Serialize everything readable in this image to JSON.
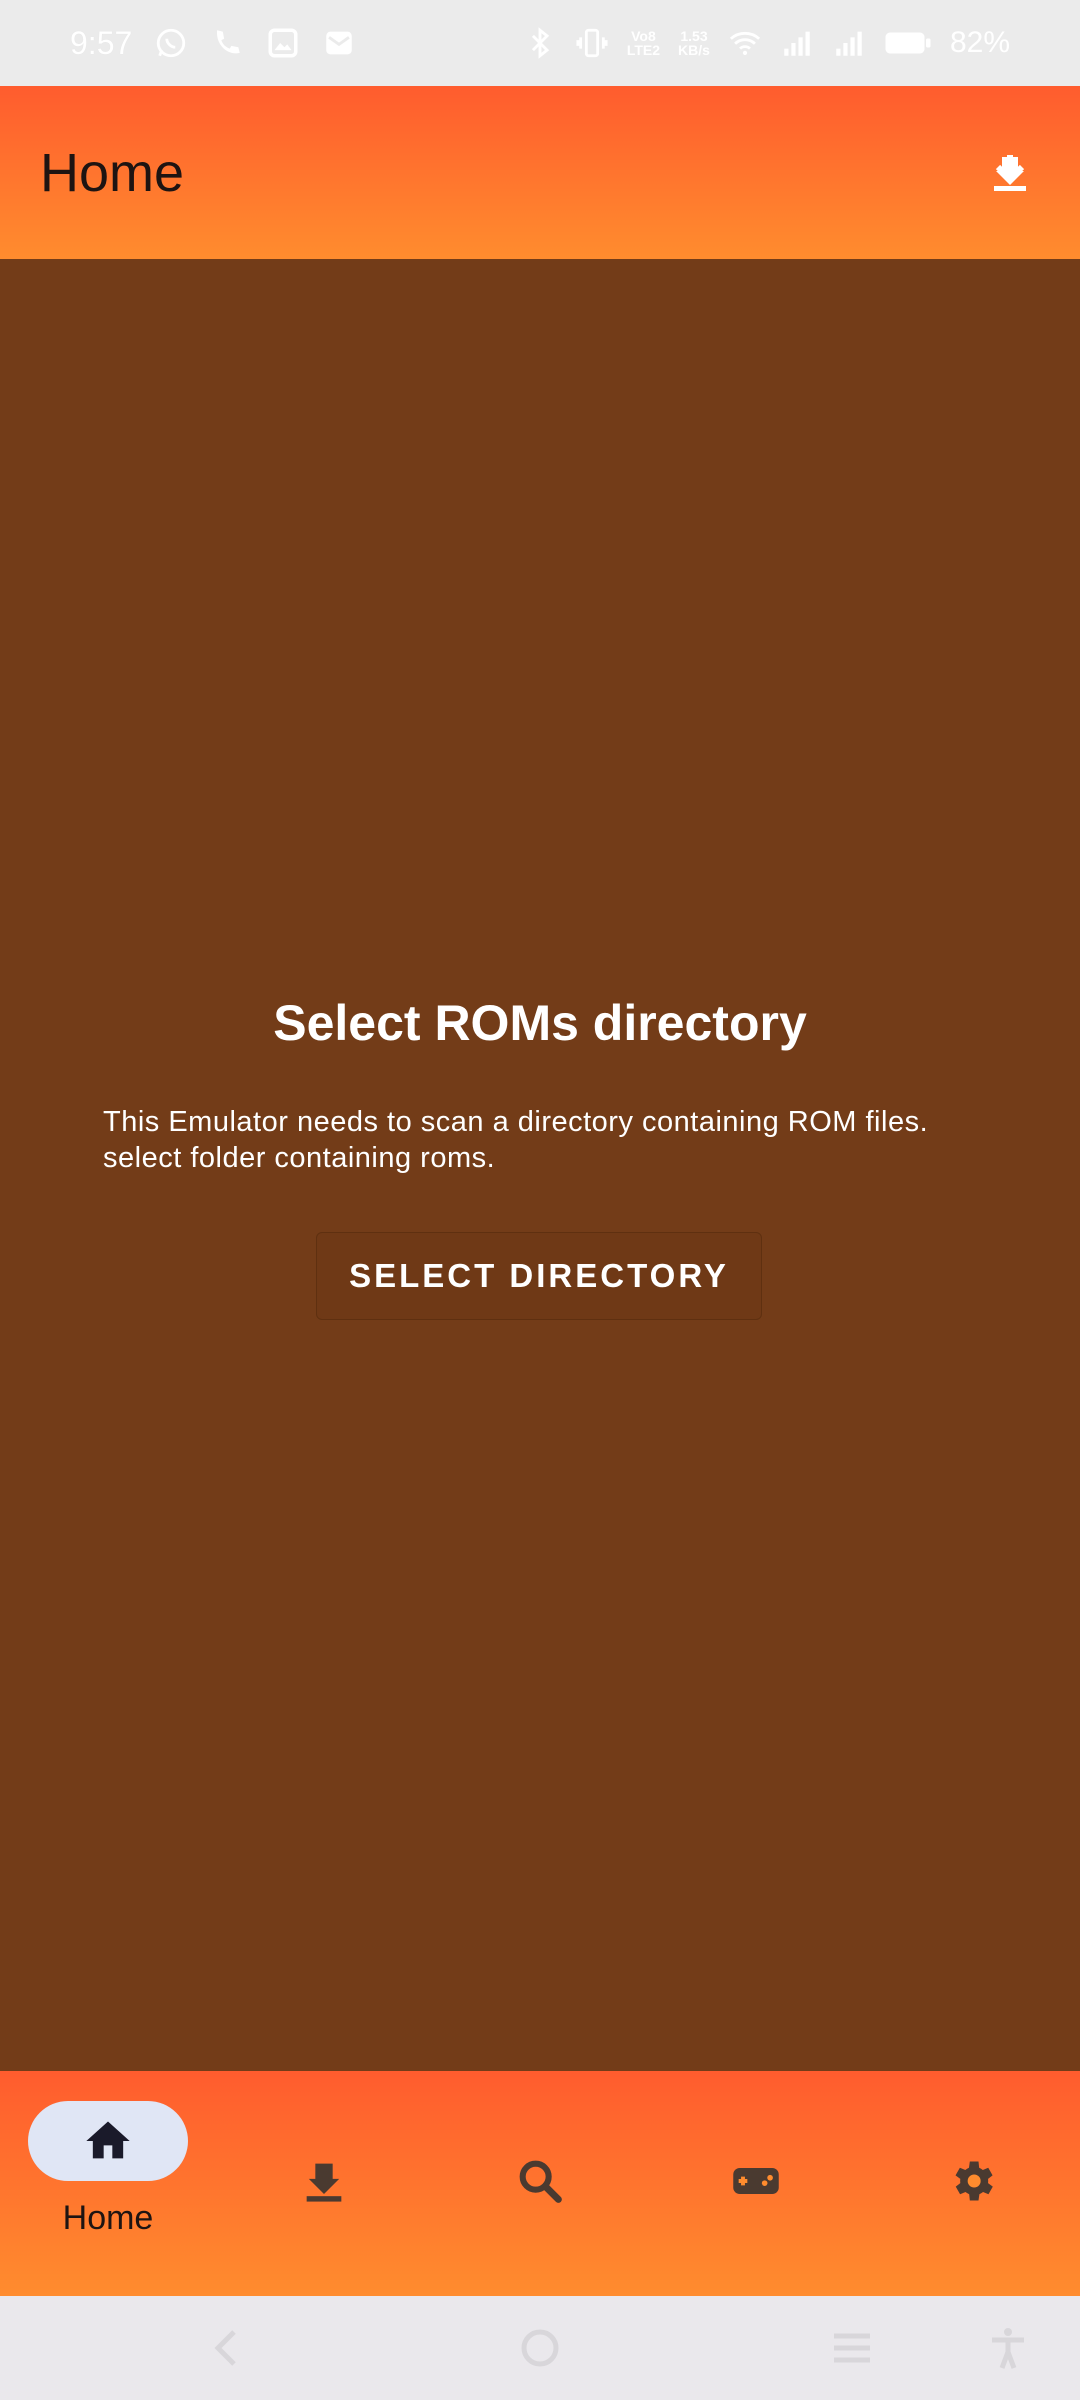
{
  "status_bar": {
    "time": "9:57",
    "net_speed_value": "1.53",
    "net_speed_unit": "KB/s",
    "lte_label_top": "Vo8",
    "lte_label_bottom": "LTE2",
    "battery_percent": "82%",
    "left_icons": [
      "whatsapp-icon",
      "call-icon",
      "gallery-icon",
      "mail-icon"
    ],
    "right_icons": [
      "bluetooth-icon",
      "vibrate-icon",
      "lte-icon",
      "net-speed",
      "wifi-icon",
      "signal-icon",
      "signal-icon",
      "battery-icon"
    ]
  },
  "app_bar": {
    "title": "Home",
    "action_icon": "download-icon"
  },
  "main": {
    "empty_state": {
      "title": "Select ROMs directory",
      "description": "This Emulator needs to scan a directory containing ROM files. select folder containing roms.",
      "button_label": "SELECT DIRECTORY"
    }
  },
  "bottom_nav": {
    "items": [
      {
        "icon": "home-icon",
        "label": "Home",
        "active": true
      },
      {
        "icon": "download-icon",
        "label": "",
        "active": false
      },
      {
        "icon": "search-icon",
        "label": "",
        "active": false
      },
      {
        "icon": "gamepad-icon",
        "label": "",
        "active": false
      },
      {
        "icon": "settings-icon",
        "label": "",
        "active": false
      }
    ]
  },
  "system_nav": {
    "buttons": [
      "back-icon",
      "home-circle-icon",
      "recents-icon",
      "accessibility-icon"
    ]
  },
  "colors": {
    "header_gradient_start": "#ff5c2e",
    "header_gradient_end": "#ff8c2e",
    "content_background": "#733c18",
    "active_nav_pill": "#e0e6f5",
    "status_bar_background": "#ebebeb",
    "system_nav_background": "#eae8ec"
  }
}
